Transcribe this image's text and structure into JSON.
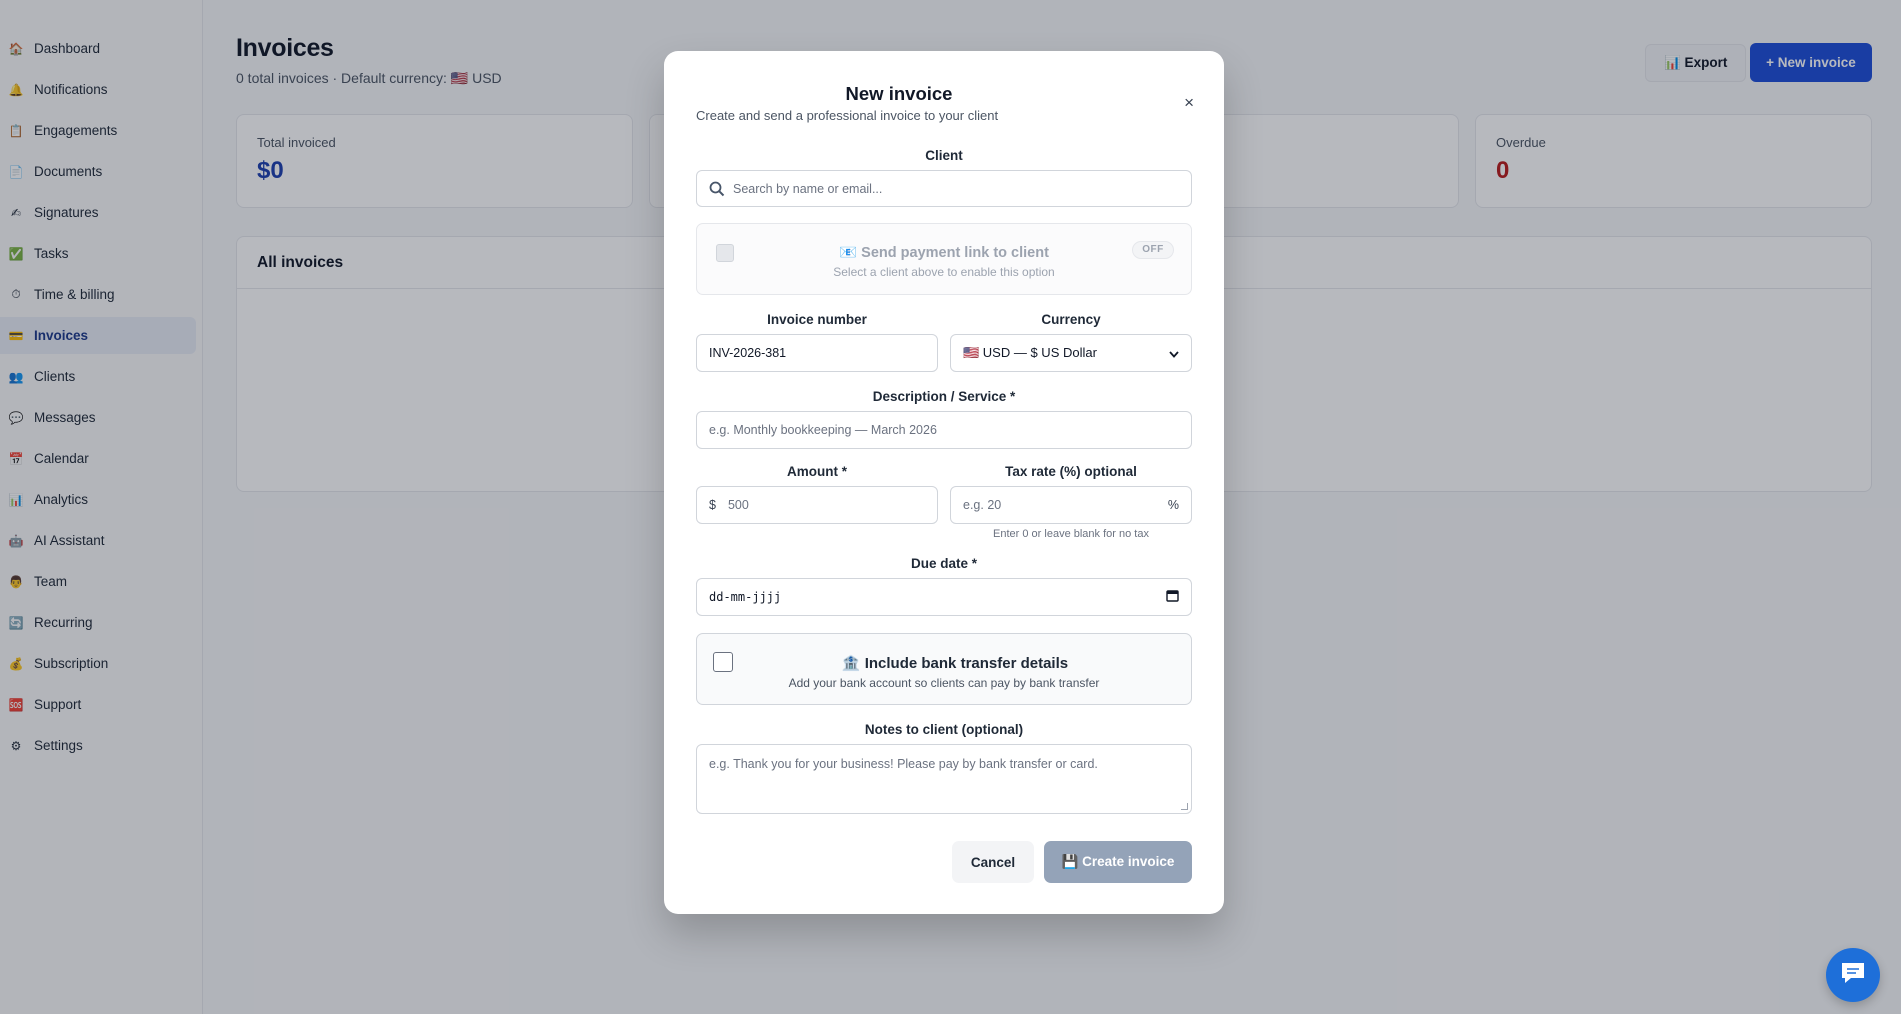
{
  "sidebar": {
    "items": [
      {
        "label": "Dashboard",
        "icon": "🏠"
      },
      {
        "label": "Notifications",
        "icon": "🔔"
      },
      {
        "label": "Engagements",
        "icon": "📋"
      },
      {
        "label": "Documents",
        "icon": "📄"
      },
      {
        "label": "Signatures",
        "icon": "✍"
      },
      {
        "label": "Tasks",
        "icon": "✅"
      },
      {
        "label": "Time & billing",
        "icon": "⏱"
      },
      {
        "label": "Invoices",
        "icon": "💳"
      },
      {
        "label": "Clients",
        "icon": "👥"
      },
      {
        "label": "Messages",
        "icon": "💬"
      },
      {
        "label": "Calendar",
        "icon": "📅"
      },
      {
        "label": "Analytics",
        "icon": "📊"
      },
      {
        "label": "AI Assistant",
        "icon": "🤖"
      },
      {
        "label": "Team",
        "icon": "👨"
      },
      {
        "label": "Recurring",
        "icon": "🔄"
      },
      {
        "label": "Subscription",
        "icon": "💰"
      },
      {
        "label": "Support",
        "icon": "🆘"
      },
      {
        "label": "Settings",
        "icon": "⚙"
      }
    ],
    "active": "Invoices"
  },
  "header": {
    "title": "Invoices",
    "subtitle": "0 total invoices · Default currency: 🇺🇸 USD",
    "export_label": "📊 Export",
    "new_label": "+ New invoice"
  },
  "stats": [
    {
      "label": "Total invoiced",
      "value": "$0",
      "color": "#1e40af"
    },
    {
      "label": "Overdue",
      "value": "0",
      "color": "#b91c1c"
    }
  ],
  "panel": {
    "title": "All invoices"
  },
  "modal": {
    "title": "New invoice",
    "subtitle": "Create and send a professional invoice to your client",
    "close": "×",
    "client_label": "Client",
    "client_placeholder": "Search by name or email...",
    "payment_title": "📧 Send payment link to client",
    "payment_sub": "Select a client above to enable this option",
    "payment_toggle": "OFF",
    "invoice_number_label": "Invoice number",
    "invoice_number_value": "INV-2026-381",
    "currency_label": "Currency",
    "currency_value": "🇺🇸 USD — $ US Dollar",
    "description_label": "Description / Service *",
    "description_placeholder": "e.g. Monthly bookkeeping — March 2026",
    "amount_label": "Amount *",
    "amount_prefix": "$",
    "amount_placeholder": "500",
    "tax_label": "Tax rate (%) optional",
    "tax_placeholder": "e.g. 20",
    "tax_suffix": "%",
    "tax_hint": "Enter 0 or leave blank for no tax",
    "due_label": "Due date *",
    "due_placeholder": "dd-mm-jjjj",
    "bank_title": "🏦 Include bank transfer details",
    "bank_sub": "Add your bank account so clients can pay by bank transfer",
    "notes_label": "Notes to client (optional)",
    "notes_placeholder": "e.g. Thank you for your business! Please pay by bank transfer or card.",
    "cancel_label": "Cancel",
    "create_label": "💾 Create invoice"
  }
}
